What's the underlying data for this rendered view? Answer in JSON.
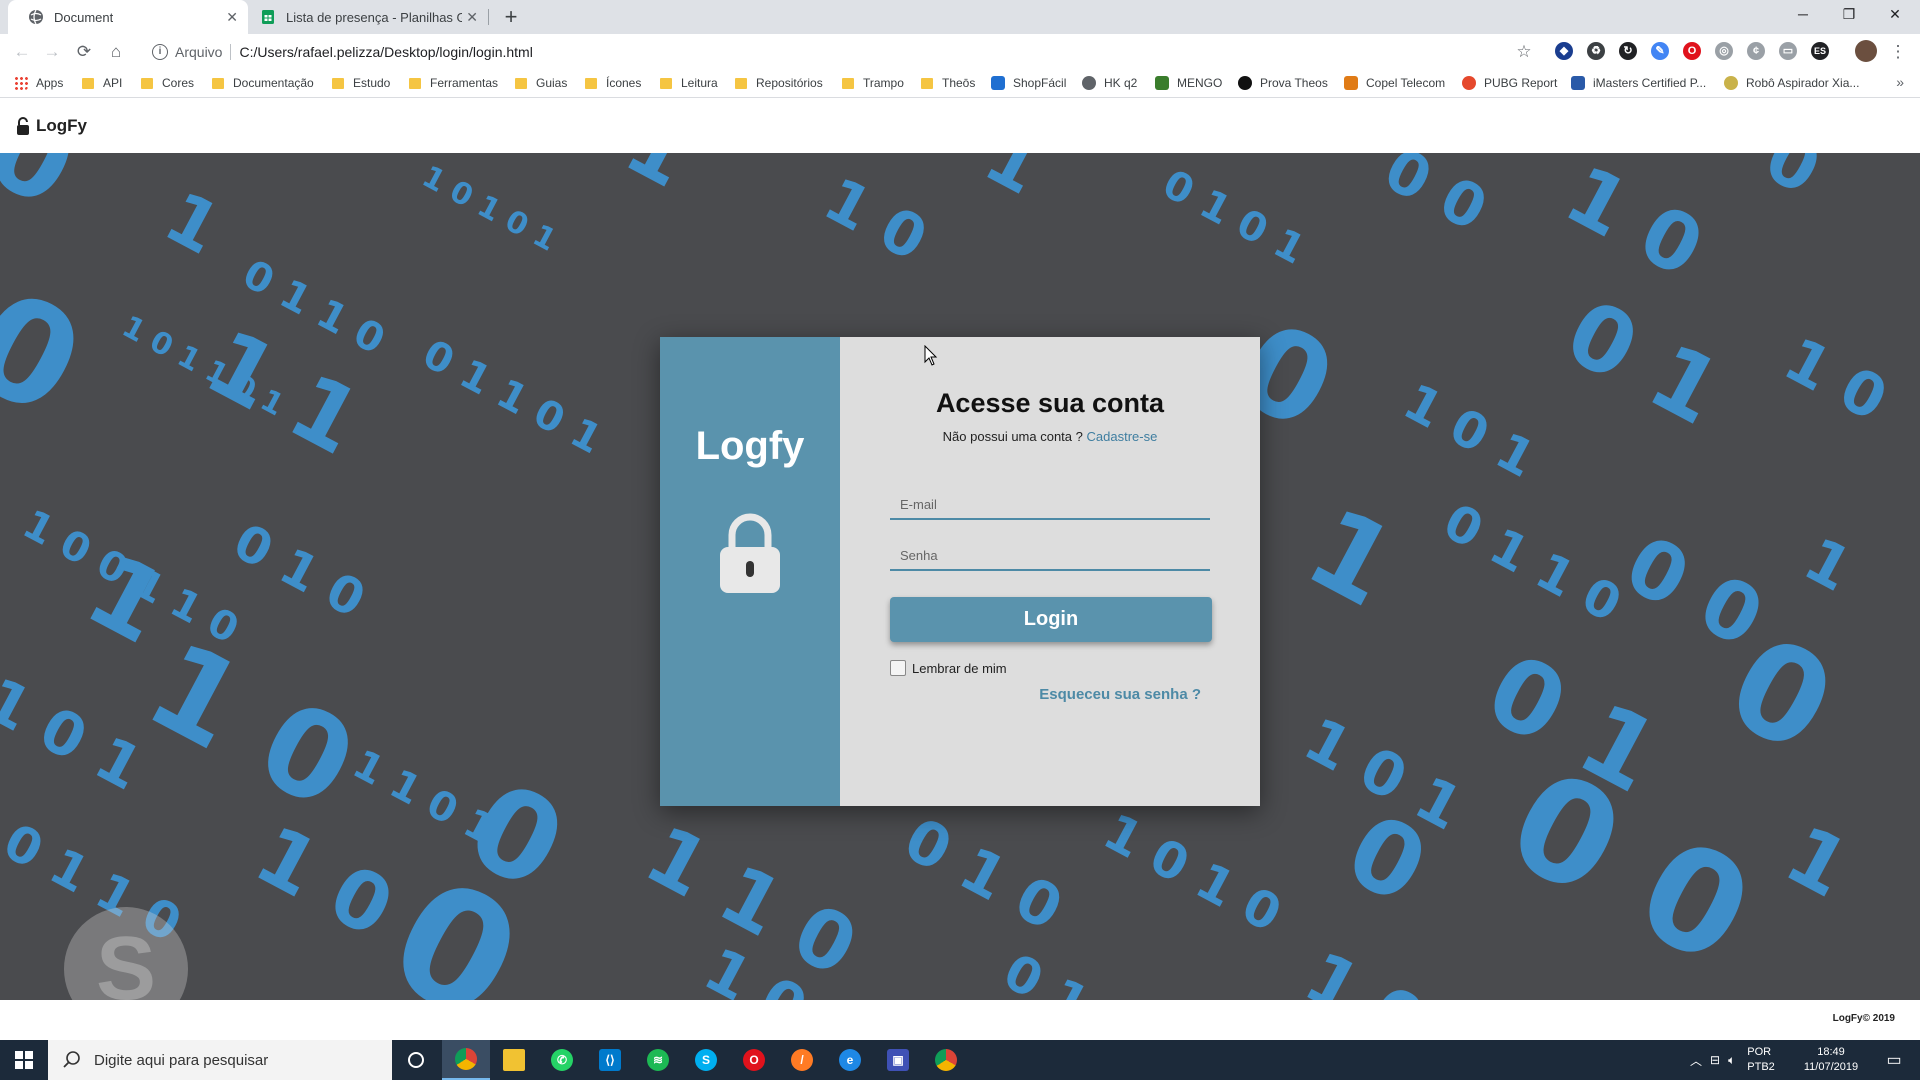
{
  "browser": {
    "tabs": [
      {
        "label": "Document",
        "active": true
      },
      {
        "label": "Lista de presença - Planilhas Goo",
        "active": false
      }
    ],
    "address_scheme": "Arquivo",
    "address_url": "C:/Users/rafael.pelizza/Desktop/login/login.html",
    "bookmarks": [
      "Apps",
      "API",
      "Cores",
      "Documentação",
      "Estudo",
      "Ferramentas",
      "Guias",
      "Ícones",
      "Leitura",
      "Repositórios",
      "Trampo",
      "Theōs",
      "ShopFácil",
      "HK q2",
      "MENGO",
      "Prova Theos",
      "Copel Telecom",
      "PUBG Report",
      "iMasters Certified P...",
      "Robô Aspirador Xia..."
    ],
    "bookmarks_more": "»"
  },
  "page": {
    "brand": "LogFy",
    "card": {
      "logo": "Logfy",
      "title": "Acesse sua conta",
      "subtitle": "Não possui uma conta ?",
      "signup_link": "Cadastre-se",
      "email_placeholder": "E-mail",
      "password_placeholder": "Senha",
      "login_button": "Login",
      "remember_label": "Lembrar de mim",
      "forgot_link": "Esqueceu sua senha ?"
    },
    "footer": "LogFy© 2019"
  },
  "taskbar": {
    "search_placeholder": "Digite aqui para pesquisar",
    "language_line1": "POR",
    "language_line2": "PTB2",
    "time": "18:49",
    "date": "11/07/2019",
    "apps": [
      "cortana-icon",
      "chrome-icon",
      "file-explorer-icon",
      "whatsapp-icon",
      "vscode-icon",
      "spotify-icon",
      "skype-icon",
      "opera-icon",
      "sublime-icon",
      "edge-icon",
      "remote-desktop-icon",
      "chrome-icon"
    ]
  },
  "colors": {
    "accent": "#5a93ad",
    "background": "#4a4b4e",
    "digits": "#3d9be0",
    "card_right": "#dddddd"
  }
}
